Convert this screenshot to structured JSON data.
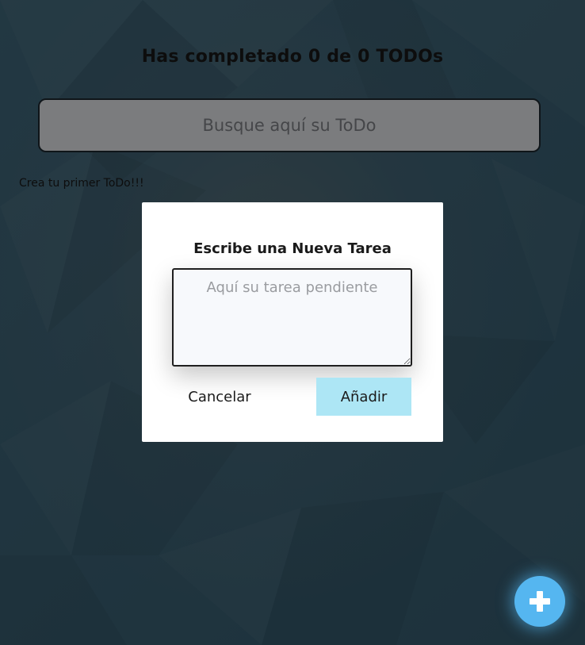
{
  "header": {
    "counter_text": "Has completado 0 de 0 TODOs"
  },
  "search": {
    "placeholder": "Busque aquí su ToDo",
    "value": ""
  },
  "todo_list": {
    "empty_message": "Crea tu primer ToDo!!!"
  },
  "modal": {
    "title": "Escribe una Nueva Tarea",
    "textarea_placeholder": "Aquí su tarea pendiente",
    "textarea_value": "",
    "cancel_label": "Cancelar",
    "add_label": "Añadir"
  },
  "fab": {
    "icon": "plus-icon"
  },
  "colors": {
    "background": "#3e6a80",
    "accent_fab": "#55b6f0",
    "add_button": "#ade6f5",
    "modal_background": "#ffffff"
  }
}
